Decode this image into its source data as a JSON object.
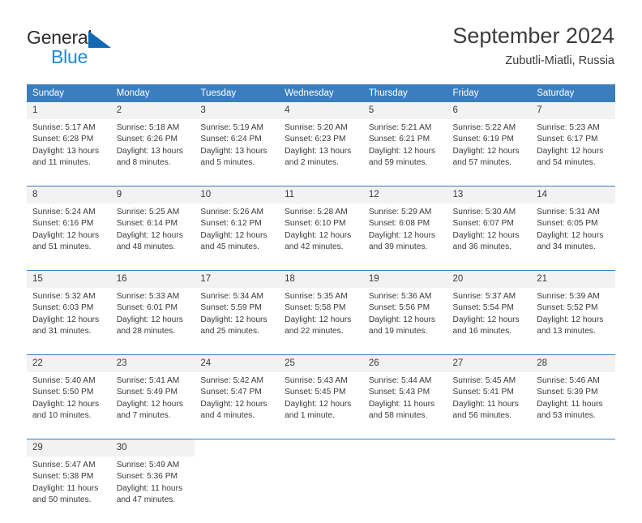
{
  "brand": {
    "name_part1": "General",
    "name_part2": "Blue",
    "accent_color": "#1268b3",
    "blue_text_color": "#1e88d8"
  },
  "header": {
    "title": "September 2024",
    "subtitle": "Zubutli-Miatli, Russia"
  },
  "calendar": {
    "header_bg": "#3a7ebf",
    "daynum_bg": "#f2f2f2",
    "weekday_names": [
      "Sunday",
      "Monday",
      "Tuesday",
      "Wednesday",
      "Thursday",
      "Friday",
      "Saturday"
    ],
    "weeks": [
      [
        {
          "day": "1",
          "sunrise": "Sunrise: 5:17 AM",
          "sunset": "Sunset: 6:28 PM",
          "daylight1": "Daylight: 13 hours",
          "daylight2": "and 11 minutes."
        },
        {
          "day": "2",
          "sunrise": "Sunrise: 5:18 AM",
          "sunset": "Sunset: 6:26 PM",
          "daylight1": "Daylight: 13 hours",
          "daylight2": "and 8 minutes."
        },
        {
          "day": "3",
          "sunrise": "Sunrise: 5:19 AM",
          "sunset": "Sunset: 6:24 PM",
          "daylight1": "Daylight: 13 hours",
          "daylight2": "and 5 minutes."
        },
        {
          "day": "4",
          "sunrise": "Sunrise: 5:20 AM",
          "sunset": "Sunset: 6:23 PM",
          "daylight1": "Daylight: 13 hours",
          "daylight2": "and 2 minutes."
        },
        {
          "day": "5",
          "sunrise": "Sunrise: 5:21 AM",
          "sunset": "Sunset: 6:21 PM",
          "daylight1": "Daylight: 12 hours",
          "daylight2": "and 59 minutes."
        },
        {
          "day": "6",
          "sunrise": "Sunrise: 5:22 AM",
          "sunset": "Sunset: 6:19 PM",
          "daylight1": "Daylight: 12 hours",
          "daylight2": "and 57 minutes."
        },
        {
          "day": "7",
          "sunrise": "Sunrise: 5:23 AM",
          "sunset": "Sunset: 6:17 PM",
          "daylight1": "Daylight: 12 hours",
          "daylight2": "and 54 minutes."
        }
      ],
      [
        {
          "day": "8",
          "sunrise": "Sunrise: 5:24 AM",
          "sunset": "Sunset: 6:16 PM",
          "daylight1": "Daylight: 12 hours",
          "daylight2": "and 51 minutes."
        },
        {
          "day": "9",
          "sunrise": "Sunrise: 5:25 AM",
          "sunset": "Sunset: 6:14 PM",
          "daylight1": "Daylight: 12 hours",
          "daylight2": "and 48 minutes."
        },
        {
          "day": "10",
          "sunrise": "Sunrise: 5:26 AM",
          "sunset": "Sunset: 6:12 PM",
          "daylight1": "Daylight: 12 hours",
          "daylight2": "and 45 minutes."
        },
        {
          "day": "11",
          "sunrise": "Sunrise: 5:28 AM",
          "sunset": "Sunset: 6:10 PM",
          "daylight1": "Daylight: 12 hours",
          "daylight2": "and 42 minutes."
        },
        {
          "day": "12",
          "sunrise": "Sunrise: 5:29 AM",
          "sunset": "Sunset: 6:08 PM",
          "daylight1": "Daylight: 12 hours",
          "daylight2": "and 39 minutes."
        },
        {
          "day": "13",
          "sunrise": "Sunrise: 5:30 AM",
          "sunset": "Sunset: 6:07 PM",
          "daylight1": "Daylight: 12 hours",
          "daylight2": "and 36 minutes."
        },
        {
          "day": "14",
          "sunrise": "Sunrise: 5:31 AM",
          "sunset": "Sunset: 6:05 PM",
          "daylight1": "Daylight: 12 hours",
          "daylight2": "and 34 minutes."
        }
      ],
      [
        {
          "day": "15",
          "sunrise": "Sunrise: 5:32 AM",
          "sunset": "Sunset: 6:03 PM",
          "daylight1": "Daylight: 12 hours",
          "daylight2": "and 31 minutes."
        },
        {
          "day": "16",
          "sunrise": "Sunrise: 5:33 AM",
          "sunset": "Sunset: 6:01 PM",
          "daylight1": "Daylight: 12 hours",
          "daylight2": "and 28 minutes."
        },
        {
          "day": "17",
          "sunrise": "Sunrise: 5:34 AM",
          "sunset": "Sunset: 5:59 PM",
          "daylight1": "Daylight: 12 hours",
          "daylight2": "and 25 minutes."
        },
        {
          "day": "18",
          "sunrise": "Sunrise: 5:35 AM",
          "sunset": "Sunset: 5:58 PM",
          "daylight1": "Daylight: 12 hours",
          "daylight2": "and 22 minutes."
        },
        {
          "day": "19",
          "sunrise": "Sunrise: 5:36 AM",
          "sunset": "Sunset: 5:56 PM",
          "daylight1": "Daylight: 12 hours",
          "daylight2": "and 19 minutes."
        },
        {
          "day": "20",
          "sunrise": "Sunrise: 5:37 AM",
          "sunset": "Sunset: 5:54 PM",
          "daylight1": "Daylight: 12 hours",
          "daylight2": "and 16 minutes."
        },
        {
          "day": "21",
          "sunrise": "Sunrise: 5:39 AM",
          "sunset": "Sunset: 5:52 PM",
          "daylight1": "Daylight: 12 hours",
          "daylight2": "and 13 minutes."
        }
      ],
      [
        {
          "day": "22",
          "sunrise": "Sunrise: 5:40 AM",
          "sunset": "Sunset: 5:50 PM",
          "daylight1": "Daylight: 12 hours",
          "daylight2": "and 10 minutes."
        },
        {
          "day": "23",
          "sunrise": "Sunrise: 5:41 AM",
          "sunset": "Sunset: 5:49 PM",
          "daylight1": "Daylight: 12 hours",
          "daylight2": "and 7 minutes."
        },
        {
          "day": "24",
          "sunrise": "Sunrise: 5:42 AM",
          "sunset": "Sunset: 5:47 PM",
          "daylight1": "Daylight: 12 hours",
          "daylight2": "and 4 minutes."
        },
        {
          "day": "25",
          "sunrise": "Sunrise: 5:43 AM",
          "sunset": "Sunset: 5:45 PM",
          "daylight1": "Daylight: 12 hours",
          "daylight2": "and 1 minute."
        },
        {
          "day": "26",
          "sunrise": "Sunrise: 5:44 AM",
          "sunset": "Sunset: 5:43 PM",
          "daylight1": "Daylight: 11 hours",
          "daylight2": "and 58 minutes."
        },
        {
          "day": "27",
          "sunrise": "Sunrise: 5:45 AM",
          "sunset": "Sunset: 5:41 PM",
          "daylight1": "Daylight: 11 hours",
          "daylight2": "and 56 minutes."
        },
        {
          "day": "28",
          "sunrise": "Sunrise: 5:46 AM",
          "sunset": "Sunset: 5:39 PM",
          "daylight1": "Daylight: 11 hours",
          "daylight2": "and 53 minutes."
        }
      ],
      [
        {
          "day": "29",
          "sunrise": "Sunrise: 5:47 AM",
          "sunset": "Sunset: 5:38 PM",
          "daylight1": "Daylight: 11 hours",
          "daylight2": "and 50 minutes."
        },
        {
          "day": "30",
          "sunrise": "Sunrise: 5:49 AM",
          "sunset": "Sunset: 5:36 PM",
          "daylight1": "Daylight: 11 hours",
          "daylight2": "and 47 minutes."
        },
        {
          "day": "",
          "sunrise": "",
          "sunset": "",
          "daylight1": "",
          "daylight2": ""
        },
        {
          "day": "",
          "sunrise": "",
          "sunset": "",
          "daylight1": "",
          "daylight2": ""
        },
        {
          "day": "",
          "sunrise": "",
          "sunset": "",
          "daylight1": "",
          "daylight2": ""
        },
        {
          "day": "",
          "sunrise": "",
          "sunset": "",
          "daylight1": "",
          "daylight2": ""
        },
        {
          "day": "",
          "sunrise": "",
          "sunset": "",
          "daylight1": "",
          "daylight2": ""
        }
      ]
    ]
  }
}
